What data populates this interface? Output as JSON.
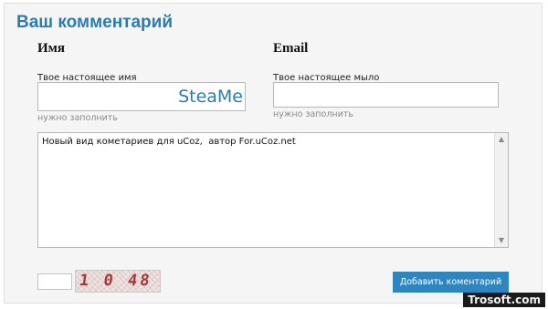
{
  "form": {
    "title": "Ваш комментарий",
    "name_heading": "Имя",
    "email_heading": "Email",
    "name_label": "Твое настоящее имя",
    "name_value": "SteaMe",
    "name_hint": "нужно заполнить",
    "email_label": "Твое настоящее мыло",
    "email_value": "",
    "email_hint": "нужно заполнить",
    "comment_text": "Новый вид кометариев для uCoz,  автор For.uCoz.net",
    "captcha_input_value": "",
    "captcha_text": "1 0 48",
    "submit_label": "Добавить коментарий"
  },
  "watermark": "Trosoft.com",
  "colors": {
    "accent": "#2a7cb0",
    "button": "#2f85c0",
    "panel_bg": "#f5f5f5"
  },
  "icons": {
    "scroll_up": "chevron-up-icon",
    "scroll_down": "chevron-down-icon"
  }
}
